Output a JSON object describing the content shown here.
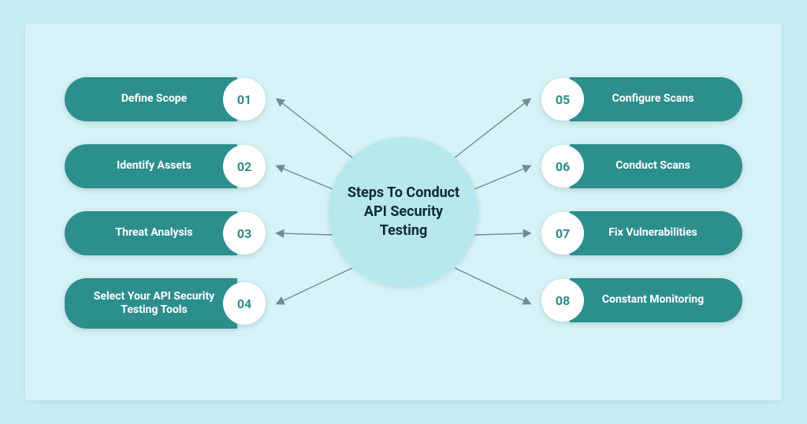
{
  "center_title": "Steps To Conduct API Security Testing",
  "steps": {
    "left": [
      {
        "num": "01",
        "label": "Define Scope"
      },
      {
        "num": "02",
        "label": "Identify Assets"
      },
      {
        "num": "03",
        "label": "Threat Analysis"
      },
      {
        "num": "04",
        "label": "Select Your API Security Testing Tools"
      }
    ],
    "right": [
      {
        "num": "05",
        "label": "Configure Scans"
      },
      {
        "num": "06",
        "label": "Conduct Scans"
      },
      {
        "num": "07",
        "label": "Fix Vulnerabilities"
      },
      {
        "num": "08",
        "label": "Constant Monitoring"
      }
    ]
  },
  "colors": {
    "page_bg": "#c4edf2",
    "canvas_bg": "#d6f4f7",
    "center_bg": "#b6e8ee",
    "pill_bg": "#2d8e8e",
    "pill_text": "#ffffff",
    "badge_bg": "#ffffff",
    "badge_text": "#2d8e8e",
    "arrow": "#6a8f93"
  }
}
